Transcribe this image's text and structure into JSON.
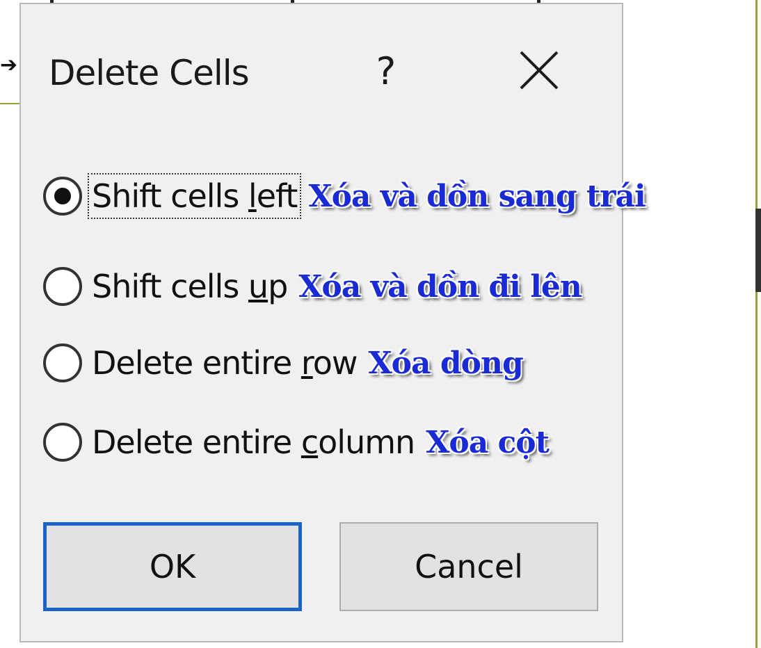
{
  "dialog": {
    "title": "Delete Cells",
    "help_label": "?",
    "close_icon": "close-icon",
    "options": [
      {
        "pre": "Shift cells ",
        "key": "l",
        "post": "eft",
        "note": "Xóa và dồn sang trái",
        "checked": true
      },
      {
        "pre": "Shift cells ",
        "key": "u",
        "post": "p",
        "note": "Xóa và dồn đi lên",
        "checked": false
      },
      {
        "pre": "Delete entire ",
        "key": "r",
        "post": "ow",
        "note": "Xóa dòng",
        "checked": false
      },
      {
        "pre": "Delete entire ",
        "key": "c",
        "post": "olumn",
        "note": "Xóa cột",
        "checked": false
      }
    ],
    "ok_label": "OK",
    "cancel_label": "Cancel"
  },
  "colors": {
    "note_text": "#1a2bd6",
    "ok_border": "#1a64c8",
    "accent_line": "#9aa33a"
  }
}
